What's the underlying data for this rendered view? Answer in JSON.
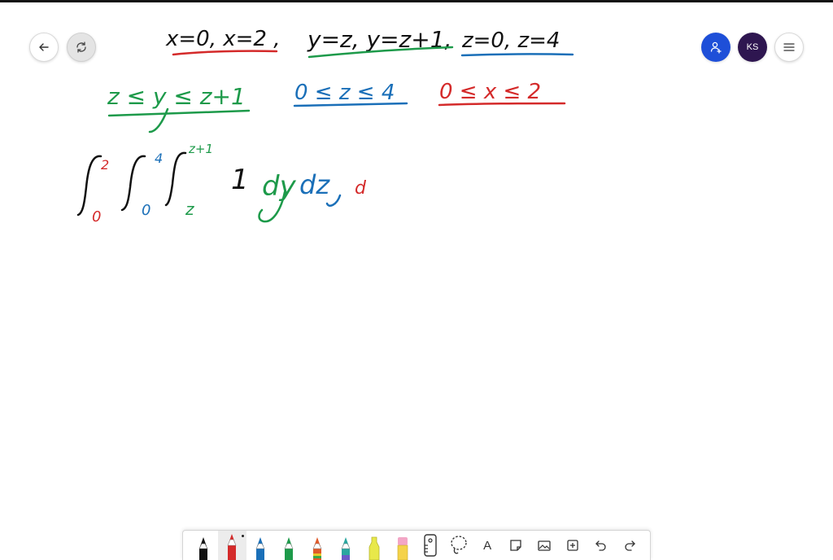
{
  "header": {
    "back_icon": "arrow-left-icon",
    "sync_icon": "sync-icon",
    "add_user_icon": "add-user-icon",
    "avatar_initials": "KS",
    "menu_icon": "hamburger-menu-icon"
  },
  "whiteboard": {
    "line1": {
      "x_bounds": "x=0, x=2 ,",
      "y_bounds": "y=z, y=z+1,",
      "z_bounds": "z=0, z=4"
    },
    "line2": {
      "y_range": "z ≤ y ≤ z+1",
      "z_range": "0 ≤ z ≤ 4",
      "x_range": "0 ≤ x ≤ 2"
    },
    "integral": {
      "outer_upper": "2",
      "outer_lower": "0",
      "middle_upper": "4",
      "middle_lower": "0",
      "inner_upper": "z+1",
      "inner_lower": "z",
      "integrand": "1",
      "d_y": "dy",
      "d_z": "dz",
      "d_x": "d"
    }
  },
  "colors": {
    "black_ink": "#111111",
    "red_ink": "#d42a2a",
    "green_ink": "#1d9a4a",
    "blue_ink": "#1a6fb8",
    "accent_blue": "#1e4fd8",
    "avatar_bg": "#2e1650"
  },
  "toolbar": {
    "tools": [
      {
        "name": "black-pen",
        "color": "#111111"
      },
      {
        "name": "red-pen",
        "color": "#d42a2a",
        "selected": true
      },
      {
        "name": "blue-pen",
        "color": "#1a6fb8"
      },
      {
        "name": "green-pen",
        "color": "#1d9a4a"
      },
      {
        "name": "rainbow-pen",
        "color": "#e05a2a"
      },
      {
        "name": "gradient-pen",
        "color": "#2aa6a0"
      },
      {
        "name": "highlighter",
        "color": "#e8e84a"
      },
      {
        "name": "eraser",
        "color": "#f3a6c6"
      }
    ],
    "text_tool_label": "A",
    "icons": [
      "ruler-icon",
      "lasso-icon",
      "text-icon",
      "sticky-note-icon",
      "image-icon",
      "add-icon",
      "undo-icon",
      "redo-icon"
    ]
  }
}
